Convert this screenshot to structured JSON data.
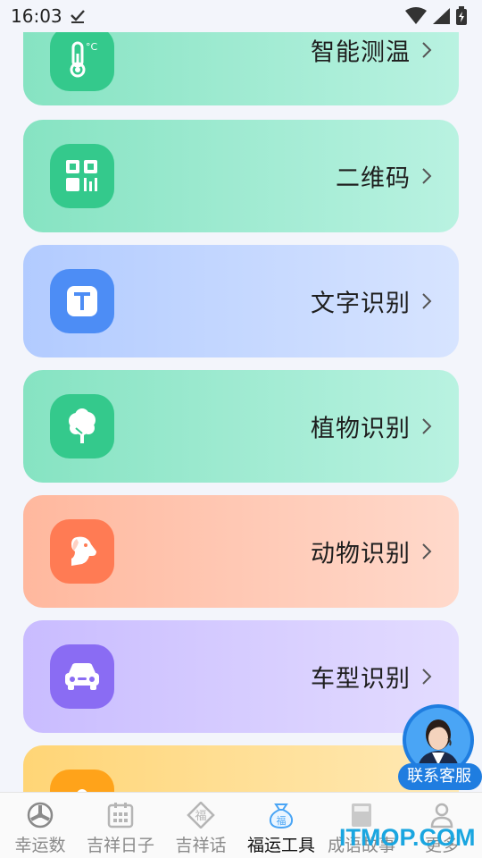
{
  "status_bar": {
    "time": "16:03"
  },
  "tools": [
    {
      "label": "智能测温",
      "icon": "thermometer-icon",
      "gradient": [
        "#86e3c2",
        "#b9f2e1"
      ],
      "icon_bg": "#34c98c"
    },
    {
      "label": "二维码",
      "icon": "qr-code-icon",
      "gradient": [
        "#86e3c2",
        "#b9f2e1"
      ],
      "icon_bg": "#34c98c"
    },
    {
      "label": "文字识别",
      "icon": "text-recognition-icon",
      "gradient": [
        "#b2cbff",
        "#d7e4ff"
      ],
      "icon_bg": "#4d8df5"
    },
    {
      "label": "植物识别",
      "icon": "tree-icon",
      "gradient": [
        "#86e3c2",
        "#b9f2e1"
      ],
      "icon_bg": "#34c98c"
    },
    {
      "label": "动物识别",
      "icon": "dog-icon",
      "gradient": [
        "#ffb89e",
        "#ffd9cb"
      ],
      "icon_bg": "#ff7b54"
    },
    {
      "label": "车型识别",
      "icon": "car-icon",
      "gradient": [
        "#c9bcff",
        "#e3dcff"
      ],
      "icon_bg": "#8a6cf3"
    },
    {
      "label": "",
      "icon": "flower-icon",
      "gradient": [
        "#ffd576",
        "#ffe9b5"
      ],
      "icon_bg": "#ffa31a"
    }
  ],
  "customer_service": {
    "label": "联系客服"
  },
  "tabbar": [
    {
      "label": "幸运数",
      "icon": "lucky-wheel-icon",
      "active": false
    },
    {
      "label": "吉祥日子",
      "icon": "calendar-icon",
      "active": false
    },
    {
      "label": "吉祥话",
      "icon": "fu-diamond-icon",
      "active": false
    },
    {
      "label": "福运工具",
      "icon": "fu-bag-icon",
      "active": true
    },
    {
      "label": "成语故事",
      "icon": "book-icon",
      "active": false
    },
    {
      "label": "更多",
      "icon": "user-icon",
      "active": false
    }
  ],
  "watermark": "ITMOP.COM"
}
